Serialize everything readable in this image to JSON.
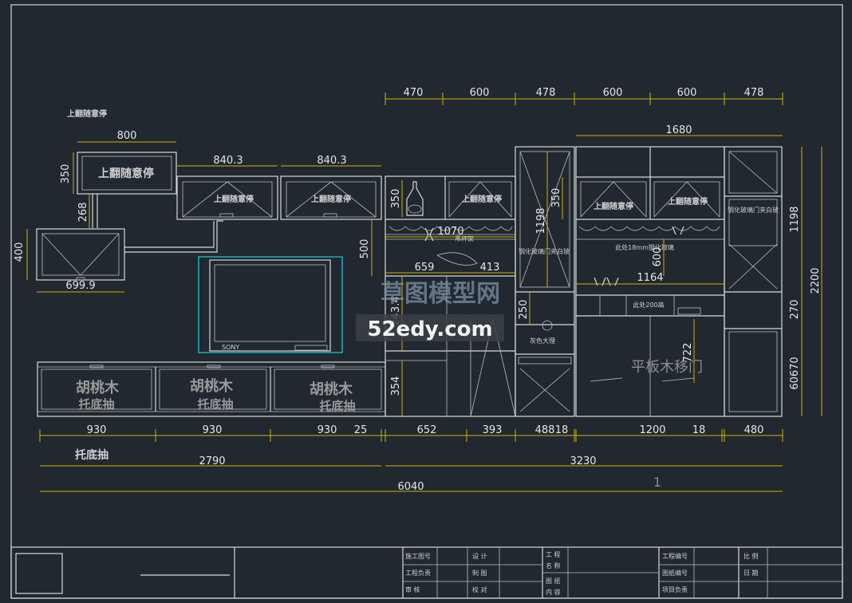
{
  "drawing": {
    "top_dims": [
      "470",
      "600",
      "478",
      "600",
      "600",
      "478"
    ],
    "dim_1680": "1680",
    "dim_800": "800",
    "dim_8403a": "840.3",
    "dim_8403b": "840.3",
    "dim_350_left": "350",
    "dim_268": "268",
    "dim_400": "400",
    "dim_6999": "699.9",
    "dim_350_mid": "350",
    "dim_500": "500",
    "dim_1070": "1070",
    "dim_659": "659",
    "dim_413": "413",
    "dim_2434": "243.4",
    "dim_354": "354",
    "dim_1198_mid": "1198",
    "dim_350_right": "350",
    "dim_250": "250",
    "dim_600_v": "600",
    "dim_1164": "1164",
    "dim_722": "722",
    "right_dims": [
      "1198",
      "2200",
      "270",
      "60670"
    ],
    "bottom_dims": [
      "930",
      "930",
      "930",
      "25",
      "652",
      "393",
      "488",
      "18",
      "1200",
      "18",
      "480"
    ],
    "dim_2790": "2790",
    "dim_3230": "3230",
    "dim_6040": "6040",
    "small_one": "1",
    "label_top_note": "上翻随意停",
    "label_box_main": "上翻随意停",
    "label_box_a": "上翻随意停",
    "label_box_b": "上翻随意停",
    "label_box_c": "上翻随意停",
    "label_box_d": "上翻随意停",
    "label_box_e": "上翻随意停",
    "walnut_1": "胡桃木",
    "walnut_2": "胡桃木",
    "walnut_3": "胡桃木",
    "tray_1": "托底抽",
    "tray_2": "托底抽",
    "tray_3": "托底抽",
    "tray_bottom": "托底抽",
    "flat_door": "平板木移门",
    "watermark_cn": "草图模型网",
    "watermark_url": "52edy.com",
    "tiny_glass": "钢化玻璃门夹白玻",
    "tiny_glass_r": "钢化玻璃门夹白玻",
    "tiny_note_a": "此处18mm钢化玻璃",
    "tiny_note_b": "此处200高",
    "tiny_rack": "吊杯架",
    "tiny_stone": "灰色大理",
    "tiny_tv": "SONY"
  },
  "titleblock": {
    "c1": [
      "施工图号",
      "工程负责",
      "审  核"
    ],
    "c2": [
      "设  计",
      "制  图",
      "校  对"
    ],
    "c3": [
      "工  程",
      "名  称"
    ],
    "c3b": [
      "图  纸",
      "内  容"
    ],
    "c4": [
      "工程编号",
      "图纸编号",
      "项目负责"
    ],
    "c5": [
      "比  例",
      "日  期"
    ]
  }
}
